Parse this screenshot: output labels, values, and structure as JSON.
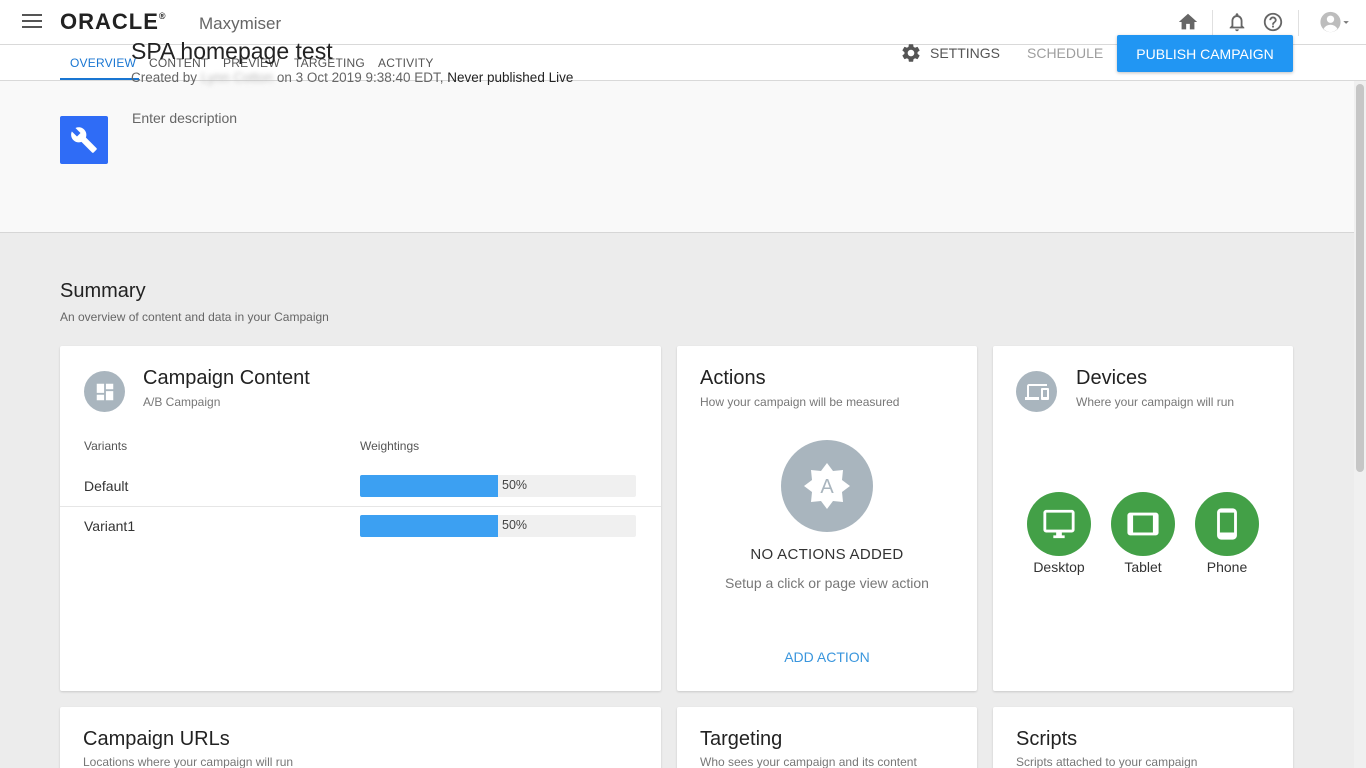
{
  "app": {
    "brand": "ORACLE",
    "brand_mark": "®",
    "product": "Maxymiser"
  },
  "tabs": [
    "OVERVIEW",
    "CONTENT",
    "PREVIEW",
    "TARGETING",
    "ACTIVITY"
  ],
  "active_tab": "OVERVIEW",
  "campaign": {
    "title": "SPA homepage test",
    "created_prefix": "Created by",
    "author": "Lynn Cotton",
    "created_suffix": "on 3 Oct 2019 9:38:40 EDT,",
    "publish_status": "Never published Live",
    "description_placeholder": "Enter description"
  },
  "header_actions": {
    "settings": "SETTINGS",
    "schedule": "SCHEDULE",
    "publish": "PUBLISH CAMPAIGN"
  },
  "summary": {
    "title": "Summary",
    "subtitle": "An overview of content and data in your Campaign"
  },
  "campaign_content": {
    "title": "Campaign Content",
    "subtitle": "A/B Campaign",
    "col_variants": "Variants",
    "col_weightings": "Weightings",
    "variants": [
      {
        "name": "Default",
        "weight_label": "50%",
        "weight": 0.5
      },
      {
        "name": "Variant1",
        "weight_label": "50%",
        "weight": 0.5
      }
    ]
  },
  "actions": {
    "title": "Actions",
    "subtitle": "How your campaign will be measured",
    "badge_letter": "A",
    "empty_title": "NO ACTIONS ADDED",
    "empty_sub": "Setup a click or page view action",
    "add_label": "ADD ACTION"
  },
  "devices": {
    "title": "Devices",
    "subtitle": "Where your campaign will run",
    "items": [
      {
        "name": "Desktop",
        "icon": "desktop-icon"
      },
      {
        "name": "Tablet",
        "icon": "tablet-icon"
      },
      {
        "name": "Phone",
        "icon": "phone-icon"
      }
    ],
    "color": "#43a047"
  },
  "bottom_cards": {
    "urls": {
      "title": "Campaign URLs",
      "subtitle": "Locations where your campaign will run"
    },
    "targeting": {
      "title": "Targeting",
      "subtitle": "Who sees your campaign and its content"
    },
    "scripts": {
      "title": "Scripts",
      "subtitle": "Scripts attached to your campaign"
    }
  },
  "colors": {
    "primary": "#2196f3",
    "campaign_icon": "#2f6cf6",
    "bar": "#3ca0f2",
    "device_green": "#43a047"
  }
}
